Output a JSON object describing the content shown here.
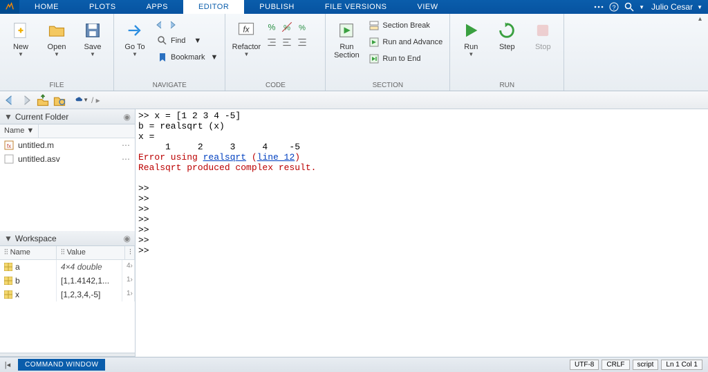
{
  "menubar": {
    "tabs": [
      "HOME",
      "PLOTS",
      "APPS",
      "EDITOR",
      "PUBLISH",
      "FILE VERSIONS",
      "VIEW"
    ],
    "active": "EDITOR",
    "user": "Julio Cesar"
  },
  "ribbon": {
    "file": {
      "new": "New",
      "open": "Open",
      "save": "Save",
      "label": "FILE"
    },
    "navigate": {
      "goto": "Go To",
      "find": "Find",
      "bookmark": "Bookmark",
      "label": "NAVIGATE"
    },
    "code": {
      "refactor": "Refactor",
      "label": "CODE"
    },
    "section": {
      "runSection": "Run\nSection",
      "break": "Section Break",
      "runAdvance": "Run and Advance",
      "runEnd": "Run to End",
      "label": "SECTION"
    },
    "run": {
      "run": "Run",
      "step": "Step",
      "stop": "Stop",
      "label": "RUN"
    }
  },
  "currentFolder": {
    "title": "Current Folder",
    "nameHeader": "Name",
    "files": [
      {
        "name": "untitled.m",
        "icon": "m"
      },
      {
        "name": "untitled.asv",
        "icon": "asv"
      }
    ]
  },
  "workspace": {
    "title": "Workspace",
    "nameHeader": "Name",
    "valueHeader": "Value",
    "vars": [
      {
        "name": "a",
        "value": "4×4 double",
        "italic": true,
        "extra": "4›"
      },
      {
        "name": "b",
        "value": "[1,1.4142,1...",
        "extra": "1›"
      },
      {
        "name": "x",
        "value": "[1,2,3,4,-5]",
        "extra": "1›"
      }
    ]
  },
  "commandWindow": {
    "lines": [
      ">> x = [1 2 3 4 -5]",
      "b = realsqrt (x)",
      "",
      "",
      "x =",
      "",
      "     1     2     3     4    -5",
      ""
    ],
    "errorUsing": "Error using ",
    "errorFunc": "realsqrt",
    "errorLineLabel": "line 12",
    "errorMsg": "Realsqrt produced complex result.",
    "prompts": [
      ">>",
      ">>",
      ">>",
      ">>",
      ">>",
      ">>",
      ">>"
    ]
  },
  "statusbar": {
    "tab": "COMMAND WINDOW",
    "encoding": "UTF-8",
    "eol": "CRLF",
    "type": "script",
    "pos": "Ln 1 Col 1"
  }
}
